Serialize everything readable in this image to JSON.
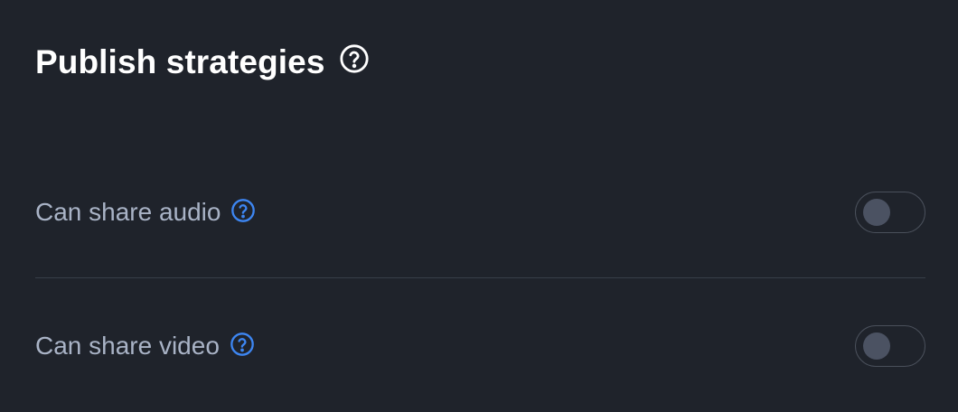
{
  "section": {
    "title": "Publish strategies",
    "title_icon": "help-circle-icon"
  },
  "settings": [
    {
      "label": "Can share audio",
      "icon": "help-circle-icon",
      "enabled": false
    },
    {
      "label": "Can share video",
      "icon": "help-circle-icon",
      "enabled": false
    }
  ],
  "colors": {
    "background": "#1f232b",
    "title": "#ffffff",
    "label": "#a9b3c6",
    "help_accent": "#3d86f2",
    "toggle_border": "#4a505b",
    "toggle_knob": "#4b5262",
    "divider": "#383e48"
  }
}
